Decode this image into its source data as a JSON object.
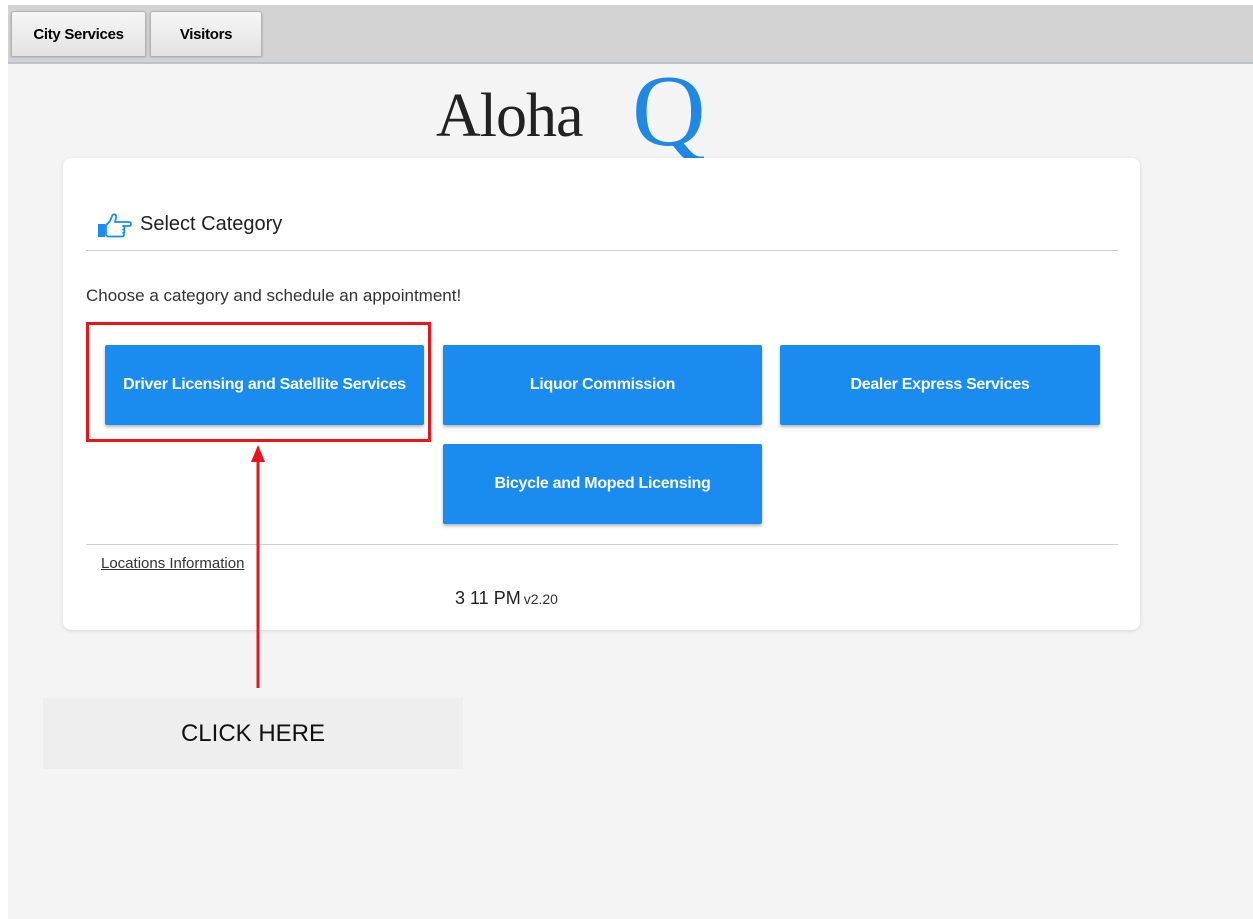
{
  "tabs": [
    {
      "label": "City Services"
    },
    {
      "label": "Visitors"
    }
  ],
  "logo": {
    "text": "Aloha",
    "accent": "Q",
    "accent_color": "#1e88e5"
  },
  "card": {
    "title": "Select Category",
    "title_icon": "hand-pointing-right-icon",
    "subtitle": "Choose a category and schedule an appointment!",
    "categories": [
      {
        "label": "Driver Licensing and Satellite Services"
      },
      {
        "label": "Liquor Commission"
      },
      {
        "label": "Dealer Express Services"
      },
      {
        "label": "Bicycle and Moped Licensing"
      }
    ],
    "locations_link": "Locations Information",
    "time": "3 11 PM",
    "version": "v2.20"
  },
  "annotation": {
    "label": "CLICK HERE",
    "highlight_color": "#e8161a"
  },
  "colors": {
    "button": "#1a8cf0",
    "tabbar": "#d3d3d3",
    "page_background": "#f4f4f4"
  }
}
